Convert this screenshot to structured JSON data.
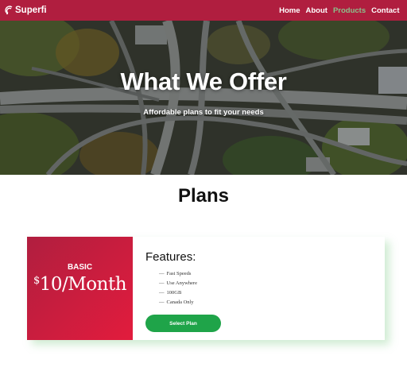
{
  "nav": {
    "brand": "Superfi",
    "links": [
      "Home",
      "About",
      "Products",
      "Contact"
    ],
    "active_index": 2
  },
  "hero": {
    "title": "What We Offer",
    "subtitle": "Affordable plans to fit your needs"
  },
  "plans": {
    "heading": "Plans",
    "card": {
      "name": "BASIC",
      "currency": "$",
      "price": "10/Month",
      "features_title": "Features:",
      "features": [
        "Fast Speeds",
        "Use Anywhere",
        "100GB",
        "Canada Only"
      ],
      "button": "Select Plan"
    }
  },
  "colors": {
    "navbar": "#b01e3f",
    "active_link": "#8bc08b",
    "plan_gradient_start": "#b01e3f",
    "plan_gradient_end": "#e21c3d",
    "button": "#1fa449"
  },
  "icons": {
    "brand": "wifi-icon"
  }
}
